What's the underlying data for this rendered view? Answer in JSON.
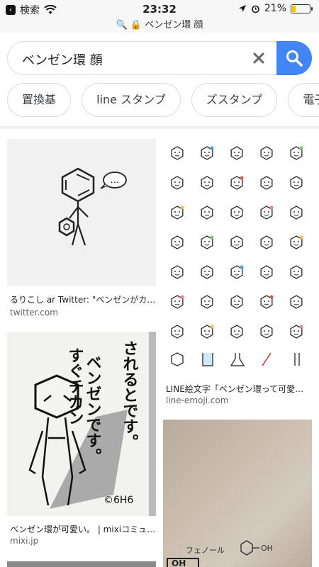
{
  "status_bar": {
    "back_label": "検索",
    "time": "23:32",
    "url": "🔍 🔒 ベンゼン環 顔",
    "battery": "21%"
  },
  "search": {
    "query": "ベンゼン環 顔"
  },
  "chips": [
    "置換基",
    "line スタンプ",
    "ズスタンプ",
    "電子像"
  ],
  "results": [
    {
      "caption": "るりこし ar Twitter: \"ベンゼンがカ…",
      "domain": "twitter.com"
    },
    {
      "caption": "LINE絵文字「ベンゼン環って可愛…",
      "domain": "line-emoji.com"
    },
    {
      "caption": "ベンゼン環が可愛い。 | mixiコミュ…",
      "domain": "mixi.jp"
    },
    {
      "caption": "",
      "domain": ""
    }
  ],
  "artwork": {
    "speech": "…",
    "vertical_text_1": "ベンゼンです。",
    "vertical_text_2": "すぐチカン",
    "vertical_text_3": "されるとです。",
    "signature": "©6H6",
    "note_text": "フェノール",
    "note_formula": "OH"
  },
  "colors": {
    "accent": "#4285f4",
    "battery": "#f5c400"
  }
}
